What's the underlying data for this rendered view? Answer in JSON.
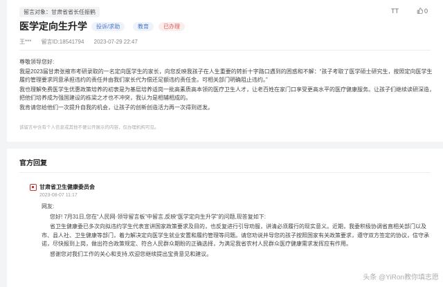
{
  "message": {
    "recipient": "留言对象：甘肃省省长任振鹤",
    "font_icon": "TT",
    "like_icon": "thumb-up-icon",
    "like_count": "0",
    "title": "医学定向生升学",
    "tags": {
      "type": "投诉/求助",
      "domain": "教育",
      "status": "已办理"
    },
    "author": "王***",
    "message_id": "留言ID:18541794",
    "time": "2023-07-29 22:47",
    "paragraphs": [
      "尊敬领导您好:",
      "我是2023届甘肃张掖市考研录取的一名定向医学生的家长，向您反映我孩子在人生重要的转折十字路口遇到的困惑和不解：“孩子考取了医学硕士研究生，按照定向医学生履约管理要求同意承担违约的责任并由我们家长代为偿还足额违约责任金。可相关部门明确阻止违约。”",
      "我也理解免费医学生优惠政策培养的初衷是为基层培养适岗一批高素质高本领的医疗卫生人才，让老百姓在家门口享受更高水平的医疗健康服务。让孩子们继续读研深造，把他们培养成为强国建设的栋梁之才也不冲突，我认为是相辅相成的。",
      "我肯请您给他们一次提升自我的机会，让孩子的创新创造活力再一次得到迸发。"
    ],
    "note": "该留言中含有个人信息或其他不便公开展示的内容，仅办理机构可见。"
  },
  "reply": {
    "section_title": "官方回复",
    "org_name": "甘肃省卫生健康委员会",
    "org_date": "2023-08-07 11:17",
    "greeting": "网友:",
    "paragraphs": [
      "您好! 7月31日,您在“人民网·领导留言板”中留言,反映“医学定向生升学”的问题,现答复如下:",
      "省卫生健康委已多次向拟违约学生代表宣讲国家政策要求及目的，也反复进行引导劝服，讲清必须履行的现实意义。近期，我委积极协调省直相关部门以及市、县人社、卫生健康等部门，着力解决定向医学生就业安置和履约管理等问题。请您劝说并导您的孩子按照国家有关政策要求，遵守双方签定的协议，信守承诺，尽快报到上岗，做出符合政策规定、符合人民群众期盼的正确选择，为满足我省农村人民群众医疗健康需求发挥应有作用。",
      "感谢您对我们工作的关心和支持,欢迎您继续提出宝贵意见和建议。"
    ],
    "watermark": "头条 @YiRon教你填志愿"
  }
}
